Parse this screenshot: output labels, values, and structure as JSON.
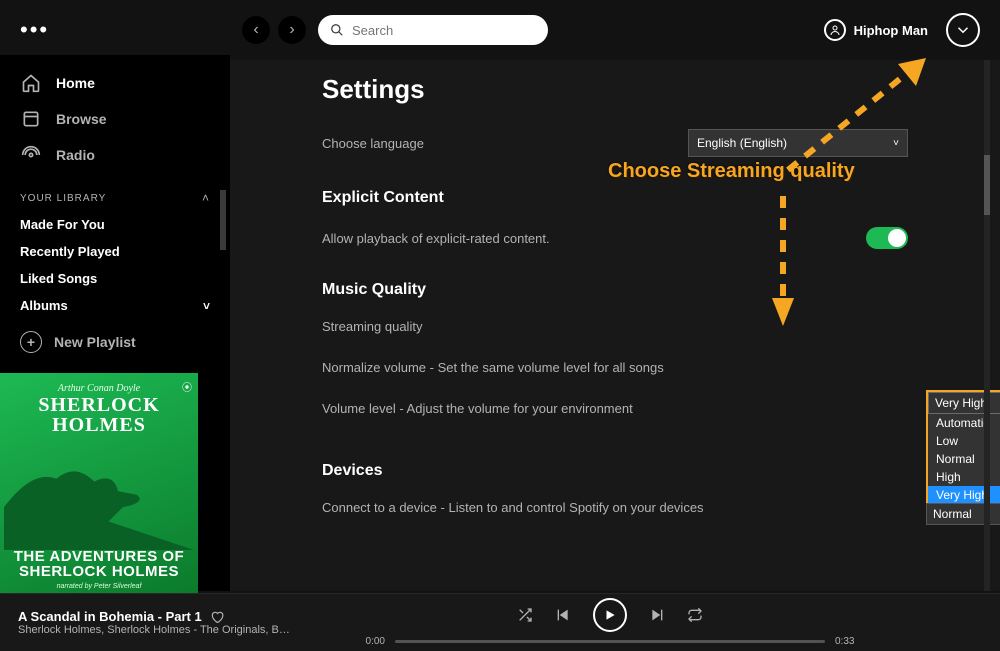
{
  "topbar": {
    "search_placeholder": "Search",
    "back_icon": "‹",
    "forward_icon": "›",
    "user_name": "Hiphop Man"
  },
  "sidebar": {
    "nav": [
      {
        "label": "Home"
      },
      {
        "label": "Browse"
      },
      {
        "label": "Radio"
      }
    ],
    "library_header": "YOUR LIBRARY",
    "library": [
      {
        "label": "Made For You"
      },
      {
        "label": "Recently Played"
      },
      {
        "label": "Liked Songs"
      },
      {
        "label": "Albums"
      }
    ],
    "new_playlist": "New Playlist",
    "cover": {
      "author": "Arthur Conan Doyle",
      "line1": "SHERLOCK",
      "line2": "HOLMES",
      "subtitle1": "THE ADVENTURES OF",
      "subtitle2": "SHERLOCK HOLMES",
      "narrator": "narrated by Peter Silverleaf"
    }
  },
  "settings": {
    "page_title": "Settings",
    "language_row": "Choose language",
    "language_select": "English (English)",
    "explicit_header": "Explicit Content",
    "explicit_row": "Allow playback of explicit-rated content.",
    "music_header": "Music Quality",
    "streaming_label": "Streaming quality",
    "normalize_label": "Normalize volume - Set the same volume level for all songs",
    "volume_level_label": "Volume level - Adjust the volume for your environment",
    "volume_level_value": "Normal",
    "devices_header": "Devices",
    "devices_row": "Connect to a device - Listen to and control Spotify on your devices",
    "quality_selected": "Very High",
    "quality_options": [
      "Automatic",
      "Low",
      "Normal",
      "High",
      "Very High"
    ]
  },
  "annotation": {
    "text": "Choose Streaming quality"
  },
  "player": {
    "track_title": "A Scandal in Bohemia - Part 1",
    "track_sub": "Sherlock Holmes, Sherlock Holmes - The Originals, B…",
    "elapsed": "0:00",
    "total": "0:33"
  }
}
